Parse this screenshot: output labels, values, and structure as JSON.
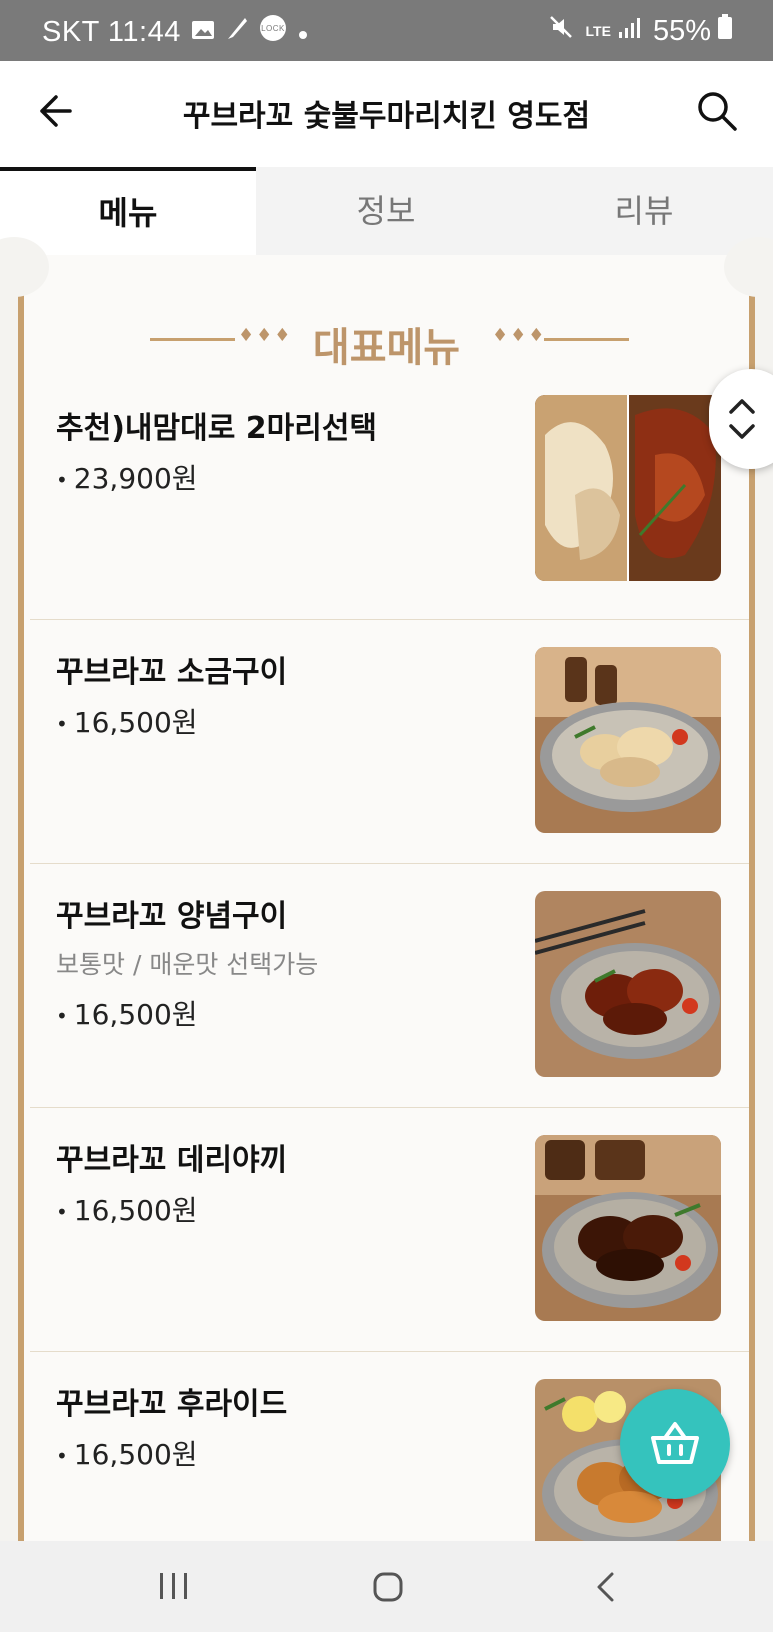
{
  "status_bar": {
    "carrier_time": "SKT 11:44",
    "network": "LTE",
    "battery": "55%"
  },
  "header": {
    "title": "꾸브라꼬 숯불두마리치킨 영도점"
  },
  "tabs": [
    {
      "label": "메뉴",
      "active": true
    },
    {
      "label": "정보",
      "active": false
    },
    {
      "label": "리뷰",
      "active": false
    }
  ],
  "section": {
    "title": "대표메뉴"
  },
  "menu_items": [
    {
      "name": "추천)내맘대로 2마리선택",
      "subtitle": "",
      "price": "23,900원"
    },
    {
      "name": "꾸브라꼬 소금구이",
      "subtitle": "",
      "price": "16,500원"
    },
    {
      "name": "꾸브라꼬 양념구이",
      "subtitle": "보통맛 / 매운맛 선택가능",
      "price": "16,500원"
    },
    {
      "name": "꾸브라꼬 데리야끼",
      "subtitle": "",
      "price": "16,500원"
    },
    {
      "name": "꾸브라꼬 후라이드",
      "subtitle": "",
      "price": "16,500원"
    }
  ],
  "colors": {
    "accent_gold": "#c7a06f",
    "cart_teal": "#35c3bd"
  }
}
